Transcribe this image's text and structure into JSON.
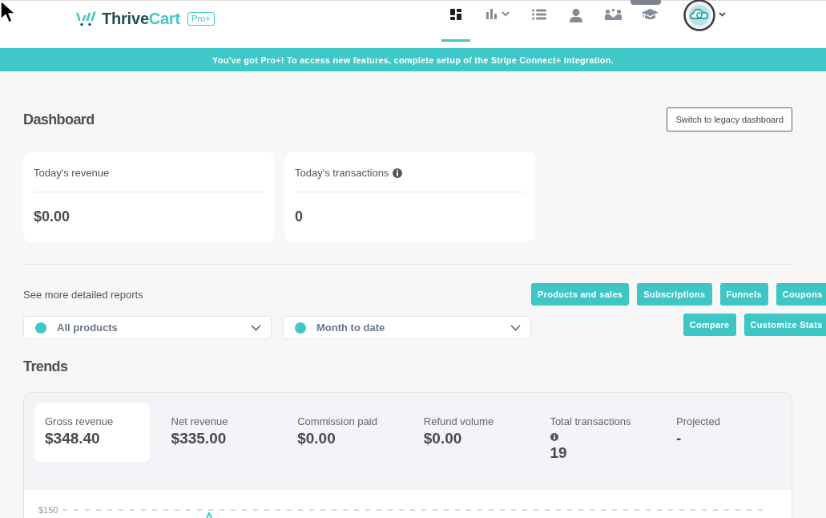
{
  "header": {
    "logo": {
      "dark_part": "Thrive",
      "accent_part": "Cart",
      "badge": "Pro+"
    },
    "nav": [
      {
        "kind": "grid",
        "selected": true,
        "badge": false
      },
      {
        "kind": "chart",
        "selected": false,
        "badge": false
      },
      {
        "kind": "list",
        "selected": false,
        "badge": false
      },
      {
        "kind": "person",
        "selected": false,
        "badge": false
      },
      {
        "kind": "team",
        "selected": false,
        "badge": false
      },
      {
        "kind": "cap",
        "selected": false,
        "badge": true
      }
    ]
  },
  "banner": {
    "text": "You've got Pro+! To access new features, complete setup of the Stripe Connect+ integration."
  },
  "dashboard": {
    "title": "Dashboard",
    "legacy_button": "Switch to legacy dashboard"
  },
  "today_cards": [
    {
      "label": "Today's revenue",
      "value": "$0.00",
      "info_icon": false
    },
    {
      "label": "Today's transactions",
      "value": "0",
      "info_icon": true
    }
  ],
  "reports": {
    "label": "See more detailed reports",
    "button_rows": [
      [
        "Products and sales",
        "Subscriptions",
        "Funnels",
        "Coupons"
      ],
      [
        "Compare",
        "Customize Stats"
      ]
    ]
  },
  "filters": [
    {
      "value": "All products"
    },
    {
      "value": "Month to date"
    }
  ],
  "trends": {
    "title": "Trends",
    "stats": [
      {
        "label": "Gross revenue",
        "value": "$348.40",
        "selected": true,
        "info_icon": false
      },
      {
        "label": "Net revenue",
        "value": "$335.00",
        "selected": false,
        "info_icon": false
      },
      {
        "label": "Commission paid",
        "value": "$0.00",
        "selected": false,
        "info_icon": false
      },
      {
        "label": "Refund volume",
        "value": "$0.00",
        "selected": false,
        "info_icon": false
      },
      {
        "label": "Total transactions",
        "value": "19",
        "selected": false,
        "info_icon": true
      },
      {
        "label": "Projected",
        "value": "-",
        "selected": false,
        "info_icon": false
      }
    ],
    "chart": {
      "tick_label": "$150"
    }
  }
}
